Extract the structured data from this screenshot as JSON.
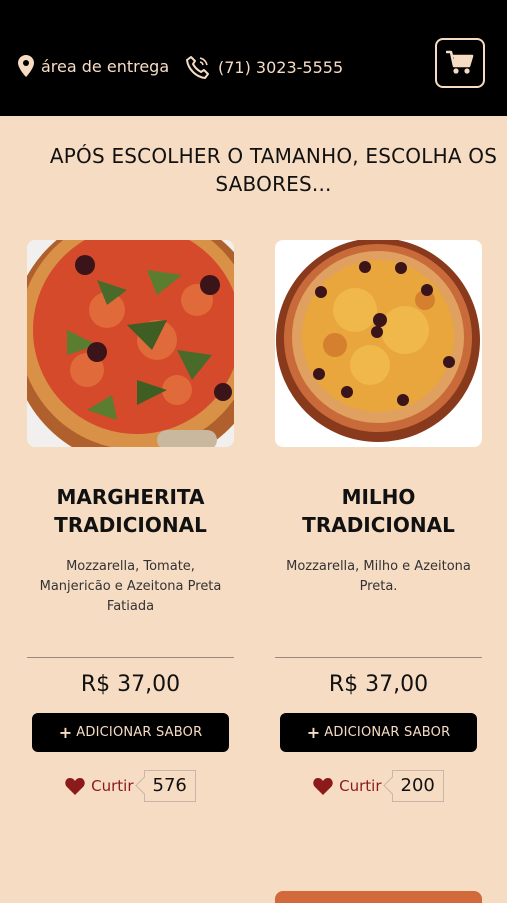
{
  "header": {
    "delivery_label": "área de entrega",
    "phone": "(71) 3023-5555",
    "icons": [
      "map-pin-icon",
      "phone-icon",
      "cart-icon"
    ]
  },
  "section_title": "APÓS ESCOLHER O TAMANHO, ESCOLHA OS SABORES...",
  "products": [
    {
      "name": "MARGHERITA TRADICIONAL",
      "description": "Mozzarella, Tomate, Manjericão e Azeitona Preta Fatiada",
      "price": "R$ 37,00",
      "button_label": "ADICIONAR SABOR",
      "like_label": "Curtir",
      "likes": "576"
    },
    {
      "name": "MILHO TRADICIONAL",
      "description": "Mozzarella, Milho e Azeitona Preta.",
      "price": "R$ 37,00",
      "button_label": "ADICIONAR SABOR",
      "like_label": "Curtir",
      "likes": "200"
    }
  ],
  "colors": {
    "background": "#f7dcc4",
    "header": "#000000",
    "accent_text": "#f7dcc4",
    "heart": "#8b1a1a"
  }
}
